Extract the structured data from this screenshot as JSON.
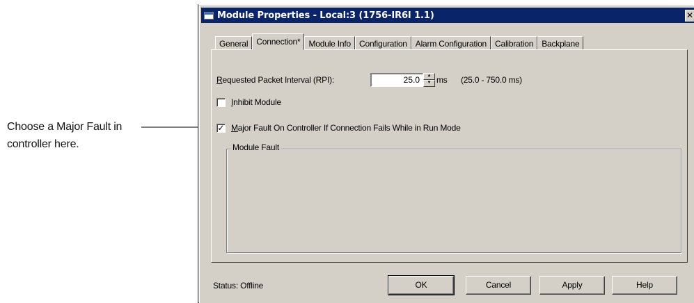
{
  "callout": {
    "line1": "Choose a Major Fault in",
    "line2": "controller here."
  },
  "window": {
    "title": "Module Properties - Local:3 (1756-IR6I 1.1)",
    "close_glyph": "✕",
    "title_color": "#0a246a"
  },
  "tabs": [
    "General",
    "Connection*",
    "Module Info",
    "Configuration",
    "Alarm Configuration",
    "Calibration",
    "Backplane"
  ],
  "active_tab": "Connection*",
  "connection": {
    "rpi_label_key": "R",
    "rpi_label_rest": "equested Packet Interval (RPI):",
    "rpi_value": "25.0",
    "rpi_unit": "ms",
    "rpi_range": "(25.0 - 750.0 ms)",
    "inhibit_key": "I",
    "inhibit_rest": "nhibit Module",
    "inhibit_checked": false,
    "major_fault_key": "M",
    "major_fault_rest": "ajor Fault On Controller If Connection Fails While in Run Mode",
    "major_fault_checked": true,
    "major_fault_check_glyph": "✓",
    "module_fault_label": "Module Fault"
  },
  "footer": {
    "status": "Status:  Offline",
    "ok": "OK",
    "cancel": "Cancel",
    "apply": "Apply",
    "help": "Help"
  }
}
